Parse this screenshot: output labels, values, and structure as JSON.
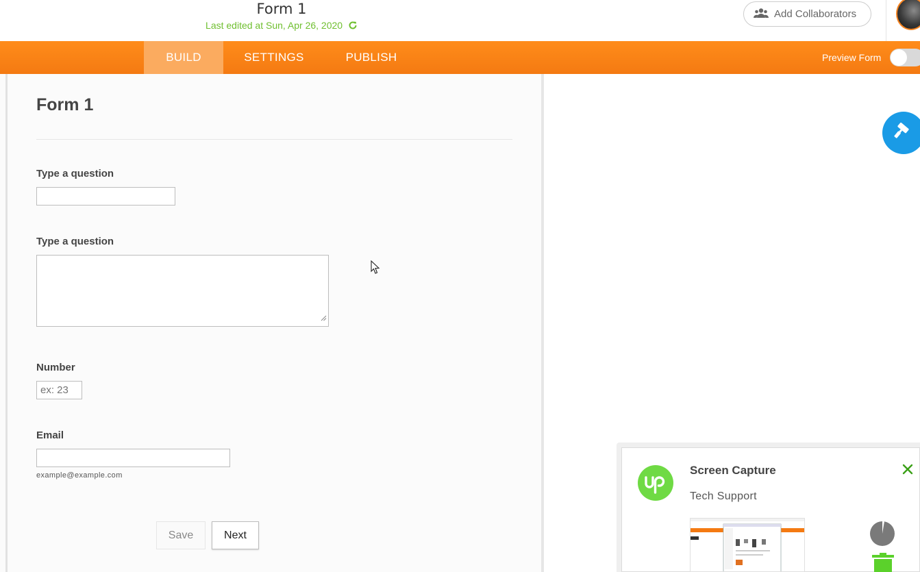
{
  "header": {
    "form_title": "Form 1",
    "last_edited": "Last edited at Sun, Apr 26, 2020",
    "add_collaborators": "Add Collaborators"
  },
  "nav": {
    "tabs": [
      {
        "label": "BUILD",
        "active": true
      },
      {
        "label": "SETTINGS",
        "active": false
      },
      {
        "label": "PUBLISH",
        "active": false
      }
    ],
    "preview_label": "Preview Form",
    "preview_on": false
  },
  "form": {
    "title": "Form 1",
    "fields": [
      {
        "label": "Type a question",
        "type": "text",
        "value": "",
        "placeholder": ""
      },
      {
        "label": "Type a question",
        "type": "textarea",
        "value": "",
        "placeholder": ""
      },
      {
        "label": "Number",
        "type": "number",
        "value": "",
        "placeholder": "ex: 23"
      },
      {
        "label": "Email",
        "type": "email",
        "value": "",
        "placeholder": "",
        "hint": "example@example.com"
      }
    ],
    "save_label": "Save",
    "next_label": "Next"
  },
  "notification": {
    "title": "Screen Capture",
    "subtitle": "Tech Support"
  },
  "colors": {
    "nav_orange": "#f47a12",
    "active_tab": "#fbab5f",
    "edited_green": "#6fbf2f",
    "fab_blue": "#1a9be6",
    "upwork_green": "#6fda44"
  },
  "icons": [
    "refresh-icon",
    "people-icon",
    "paint-roller-icon",
    "close-icon",
    "pie-icon",
    "trash-icon",
    "cursor-icon"
  ]
}
